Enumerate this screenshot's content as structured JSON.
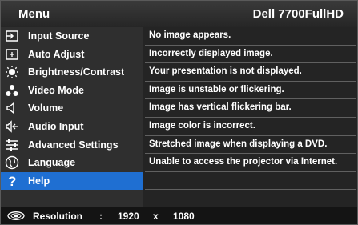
{
  "header": {
    "title": "Menu",
    "model": "Dell 7700FullHD"
  },
  "menu": {
    "items": [
      {
        "label": "Input Source",
        "icon": "input-source-icon"
      },
      {
        "label": "Auto Adjust",
        "icon": "auto-adjust-icon"
      },
      {
        "label": "Brightness/Contrast",
        "icon": "brightness-icon"
      },
      {
        "label": "Video Mode",
        "icon": "video-mode-icon"
      },
      {
        "label": "Volume",
        "icon": "volume-icon"
      },
      {
        "label": "Audio Input",
        "icon": "audio-input-icon"
      },
      {
        "label": "Advanced Settings",
        "icon": "advanced-settings-icon"
      },
      {
        "label": "Language",
        "icon": "language-icon"
      },
      {
        "label": "Help",
        "icon": "help-icon",
        "selected": true
      }
    ]
  },
  "help": {
    "options": [
      "No image appears.",
      "Incorrectly displayed image.",
      "Your presentation is not displayed.",
      "Image is unstable or flickering.",
      "Image has vertical flickering bar.",
      "Image color is incorrect.",
      "Stretched image when displaying a DVD.",
      "Unable to access the projector via Internet.",
      "",
      ""
    ]
  },
  "footer": {
    "label": "Resolution",
    "sep": ":",
    "width": "1920",
    "x": "x",
    "height": "1080",
    "icon": "resolution-icon"
  },
  "colors": {
    "selected": "#1f6fd2",
    "panel": "#2e2e2e"
  }
}
